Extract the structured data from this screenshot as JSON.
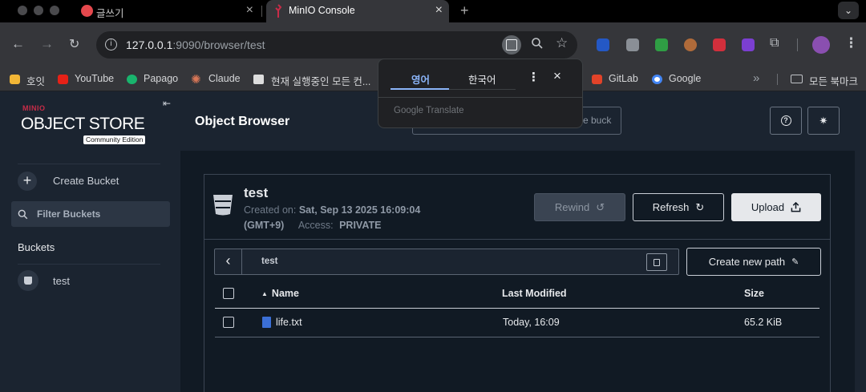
{
  "browser": {
    "tabs": [
      {
        "title": "글쓰기",
        "active": false
      },
      {
        "title": "MinIO Console",
        "active": true
      }
    ],
    "new_tab_icon": "+",
    "url_host": "127.0.0.1",
    "url_path": ":9090/browser/test",
    "bookmarks": [
      "호잇",
      "YouTube",
      "Papago",
      "Claude",
      "현재 실행중인 모든 컨...",
      "GitLab",
      "Google",
      "모든 북마크"
    ],
    "bookmarks_overflow": "»"
  },
  "translate_popup": {
    "lang_source": "영어",
    "lang_target": "한국어",
    "provider": "Google Translate"
  },
  "sidebar": {
    "brand_top": "MINIO",
    "brand_main": "OBJECT STORE",
    "brand_edition": "Community Edition",
    "create_bucket": "Create Bucket",
    "filter_placeholder": "Filter Buckets",
    "buckets_heading": "Buckets",
    "buckets": [
      "test"
    ]
  },
  "header": {
    "title": "Object Browser",
    "search_partial": "e buck"
  },
  "bucket": {
    "name": "test",
    "created_label": "Created on:",
    "created_value": "Sat, Sep 13 2025 16:09:04",
    "timezone": "(GMT+9)",
    "access_label": "Access:",
    "access_value": "PRIVATE",
    "rewind_label": "Rewind",
    "refresh_label": "Refresh",
    "upload_label": "Upload"
  },
  "pathbar": {
    "path": "test",
    "create_path_label": "Create new path"
  },
  "table": {
    "columns": [
      "Name",
      "Last Modified",
      "Size"
    ],
    "rows": [
      {
        "name": "life.txt",
        "modified": "Today, 16:09",
        "size": "65.2 KiB"
      }
    ]
  },
  "colors": {
    "sidebar_bg": "#1b2430",
    "main_bg": "#111a24",
    "accent_red": "#c72c48"
  }
}
